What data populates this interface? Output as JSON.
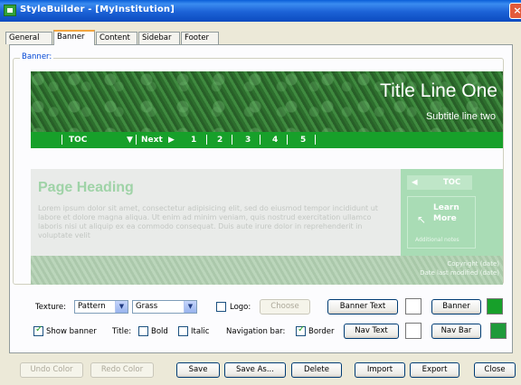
{
  "window": {
    "title": "StyleBuilder - [MyInstitution]",
    "close": "×"
  },
  "tabs": [
    "General",
    "Banner",
    "Content",
    "Sidebar",
    "Footer"
  ],
  "group_label": "Banner:",
  "preview": {
    "title": "Title Line One",
    "subtitle": "Subtitle line two",
    "nav": [
      "TOC",
      "Next",
      "1",
      "2",
      "3",
      "4",
      "5"
    ],
    "page_heading": "Page Heading",
    "body_text": "Lorem ipsum dolor sit amet, consectetur adipisicing elit, sed do eiusmod tempor incididunt ut labore et dolore magna aliqua. Ut enim ad minim veniam, quis nostrud exercitation ullamco laboris nisi ut aliquip ex ea commodo consequat. Duis aute irure dolor in reprehenderit in voluptate velit",
    "sidebar_toc": "TOC",
    "learn_more": "Learn More",
    "additional_notes": "Additional notes",
    "copyright": "Copyright (date)",
    "date_modified": "Date last modified (date)"
  },
  "controls": {
    "texture_label": "Texture:",
    "texture_value": "Pattern",
    "pattern_value": "Grass",
    "logo_label": "Logo:",
    "choose": "Choose",
    "banner_text": "Banner Text",
    "banner": "Banner",
    "show_banner": "Show banner",
    "title_label": "Title:",
    "bold": "Bold",
    "italic": "Italic",
    "nav_bar_label": "Navigation bar:",
    "border": "Border",
    "nav_text": "Nav Text",
    "nav_bar": "Nav Bar"
  },
  "colors": {
    "banner_text_swatch": "#ffffff",
    "banner_swatch": "#17a02a",
    "nav_text_swatch": "#ffffff",
    "nav_bar_swatch": "#1f9a3a"
  },
  "bottom": [
    "Undo Color",
    "Redo Color",
    "Save",
    "Save As...",
    "Delete",
    "Import",
    "Export",
    "Close"
  ]
}
